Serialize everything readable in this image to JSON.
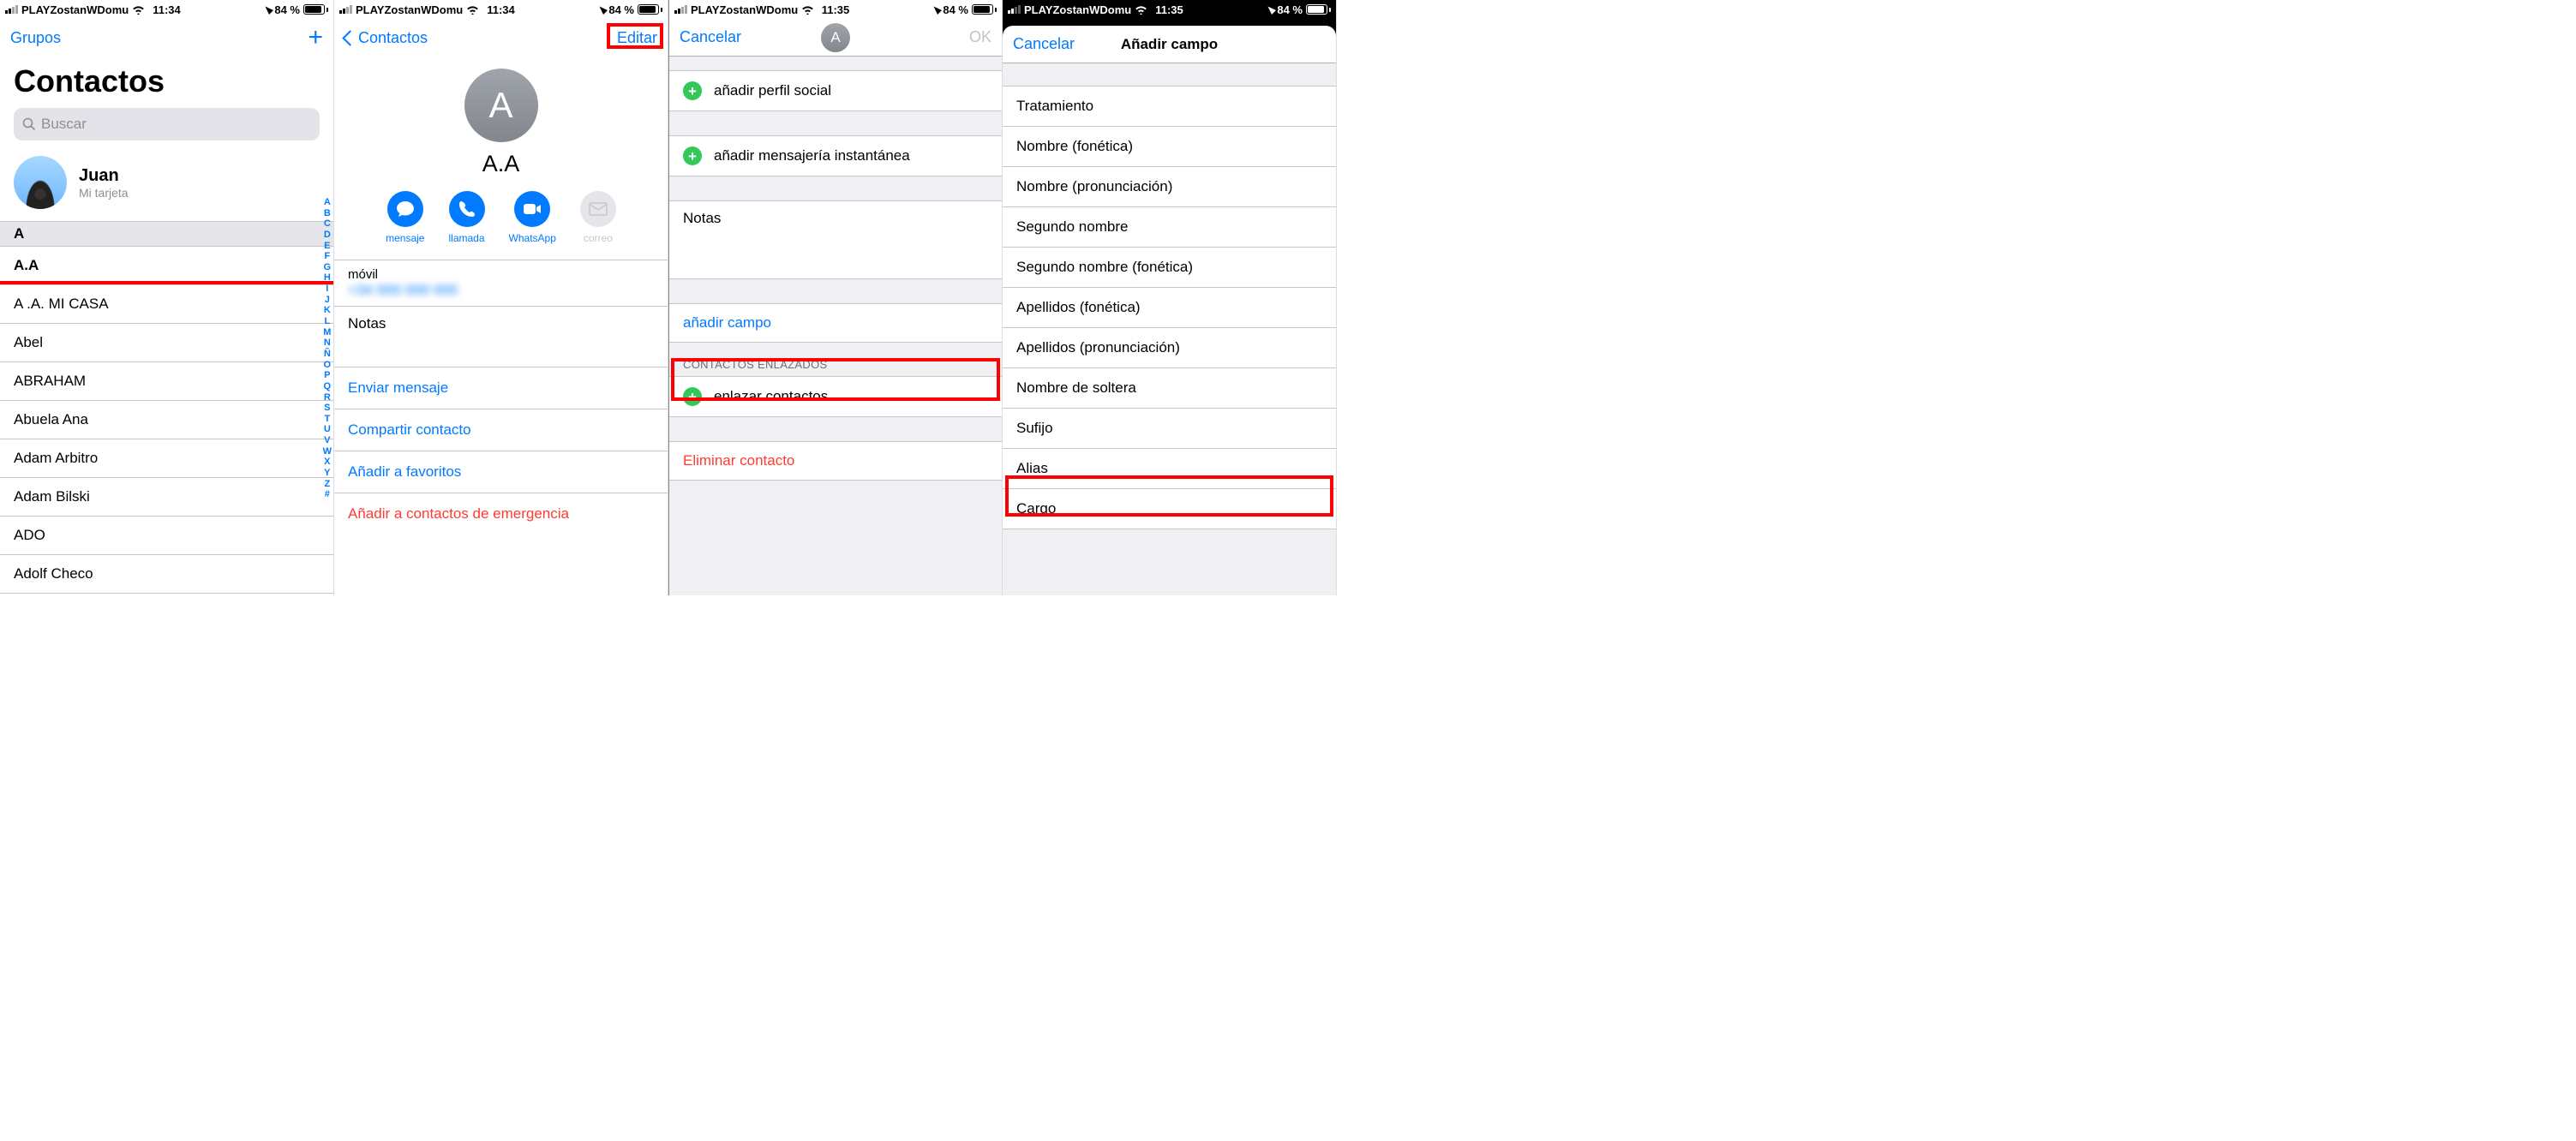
{
  "status": {
    "carrier": "PLAYZostanWDomu",
    "time1": "11:34",
    "time2": "11:35",
    "battery_pct": "84 %",
    "battery_fill": 84
  },
  "s1": {
    "nav_left": "Grupos",
    "title": "Contactos",
    "search_placeholder": "Buscar",
    "me": {
      "name": "Juan",
      "sub": "Mi tarjeta"
    },
    "section": "A",
    "contacts": [
      "A.A",
      "A .A. MI CASA",
      "Abel",
      "ABRAHAM",
      "Abuela Ana",
      "Adam Arbitro",
      "Adam Bilski",
      "ADO",
      "Adolf Checo"
    ],
    "index": [
      "A",
      "B",
      "C",
      "D",
      "E",
      "F",
      "G",
      "H",
      "I",
      "J",
      "K",
      "L",
      "M",
      "N",
      "Ñ",
      "O",
      "P",
      "Q",
      "R",
      "S",
      "T",
      "U",
      "V",
      "W",
      "X",
      "Y",
      "Z",
      "#"
    ]
  },
  "s2": {
    "back": "Contactos",
    "edit": "Editar",
    "avatar_letter": "A",
    "name": "A.A",
    "actions": {
      "msg": "mensaje",
      "call": "llamada",
      "wa": "WhatsApp",
      "mail": "correo"
    },
    "phone_label": "móvil",
    "phone_value_prefix": "+34",
    "notes_label": "Notas",
    "links": {
      "send": "Enviar mensaje",
      "share": "Compartir contacto",
      "fav": "Añadir a favoritos",
      "emerg": "Añadir a contactos de emergencia"
    }
  },
  "s3": {
    "cancel": "Cancelar",
    "ok": "OK",
    "avatar_letter": "A",
    "add_social": "añadir perfil social",
    "add_im": "añadir mensajería instantánea",
    "notes": "Notas",
    "add_field": "añadir campo",
    "linked_header": "CONTACTOS ENLAZADOS",
    "link_contacts": "enlazar contactos…",
    "delete": "Eliminar contacto"
  },
  "s4": {
    "cancel": "Cancelar",
    "title": "Añadir campo",
    "fields": [
      "Tratamiento",
      "Nombre (fonética)",
      "Nombre (pronunciación)",
      "Segundo nombre",
      "Segundo nombre (fonética)",
      "Apellidos (fonética)",
      "Apellidos (pronunciación)",
      "Nombre de soltera",
      "Sufijo",
      "Alias",
      "Cargo"
    ]
  }
}
